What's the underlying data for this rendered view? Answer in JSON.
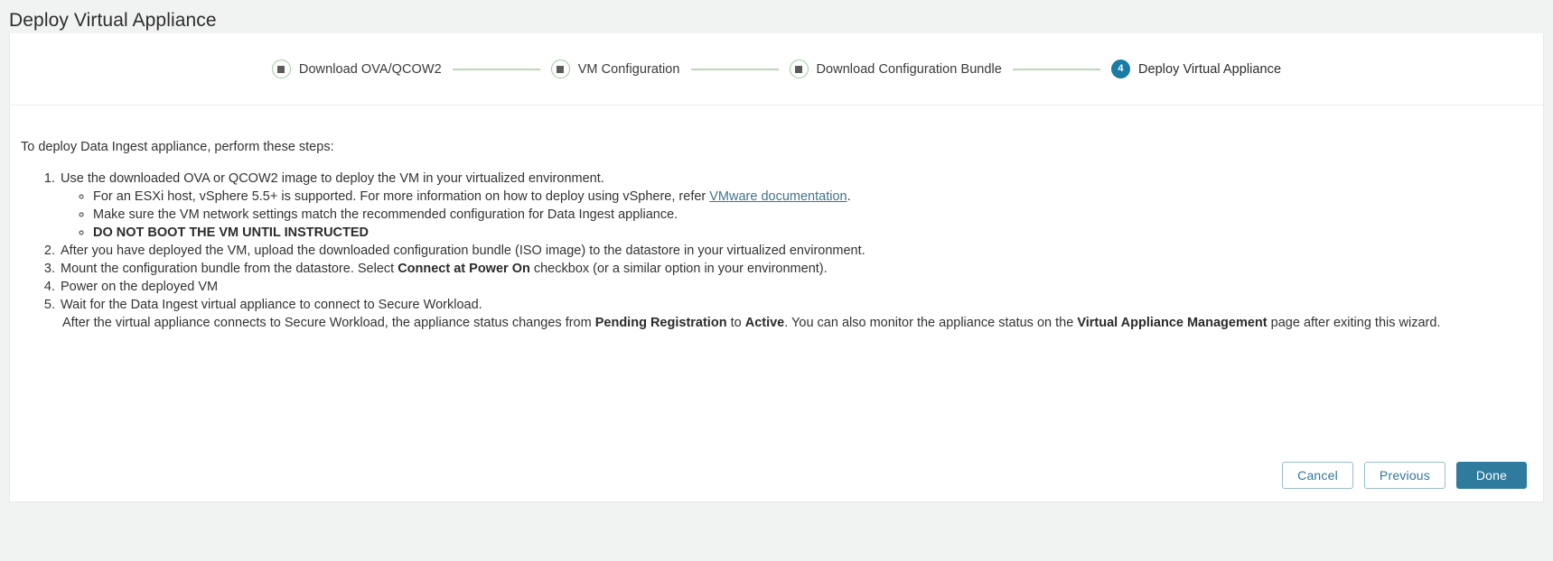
{
  "header": {
    "title": "Deploy Virtual Appliance"
  },
  "stepper": {
    "steps": [
      {
        "id": "download-ova",
        "label": "Download OVA/QCOW2",
        "state": "done",
        "number": "1",
        "icon": "square-marker-icon"
      },
      {
        "id": "vm-configuration",
        "label": "VM Configuration",
        "state": "done",
        "number": "2",
        "icon": "square-marker-icon"
      },
      {
        "id": "download-configuration-bundle",
        "label": "Download Configuration Bundle",
        "state": "done",
        "number": "3",
        "icon": "square-marker-icon"
      },
      {
        "id": "deploy-virtual-appliance",
        "label": "Deploy Virtual Appliance",
        "state": "current",
        "number": "4",
        "icon": "step-number-icon"
      }
    ]
  },
  "main": {
    "intro": "To deploy Data Ingest appliance, perform these steps:",
    "items": [
      {
        "text_before": "Use the downloaded OVA or QCOW2 image to deploy the VM in your virtualized environment.",
        "sub_items": [
          {
            "prefix": "For an ESXi host, vSphere 5.5+ is supported. For more information on how to deploy using vSphere, refer ",
            "link": "VMware documentation",
            "suffix": ".",
            "bold": false
          },
          {
            "prefix": "Make sure the VM network settings match the recommended configuration for Data Ingest appliance.",
            "link": "",
            "suffix": "",
            "bold": false
          },
          {
            "prefix": "DO NOT BOOT THE VM UNTIL INSTRUCTED",
            "link": "",
            "suffix": "",
            "bold": true
          }
        ]
      },
      {
        "text_before": "After you have deployed the VM, upload the downloaded configuration bundle (ISO image) to the datastore in your virtualized environment.",
        "sub_items": []
      },
      {
        "segments": [
          {
            "text": "Mount the configuration bundle from the datastore. Select ",
            "bold": false
          },
          {
            "text": "Connect at Power On",
            "bold": true
          },
          {
            "text": " checkbox (or a similar option in your environment).",
            "bold": false
          }
        ],
        "sub_items": []
      },
      {
        "text_before": "Power on the deployed VM",
        "sub_items": []
      },
      {
        "text_before": "Wait for the Data Ingest virtual appliance to connect to Secure Workload.",
        "followup_segments": [
          {
            "text": "After the virtual appliance connects to Secure Workload, the appliance status changes from ",
            "bold": false
          },
          {
            "text": "Pending Registration",
            "bold": true
          },
          {
            "text": " to ",
            "bold": false
          },
          {
            "text": "Active",
            "bold": true
          },
          {
            "text": ". You can also monitor the appliance status on the ",
            "bold": false
          },
          {
            "text": "Virtual Appliance Management",
            "bold": true
          },
          {
            "text": " page after exiting this wizard.",
            "bold": false
          }
        ],
        "sub_items": []
      }
    ]
  },
  "footer": {
    "cancel_label": "Cancel",
    "previous_label": "Previous",
    "done_label": "Done"
  },
  "colors": {
    "accent": "#2e7b9e",
    "step_done_ring": "#9ecb9e",
    "connector": "#b7d9b3",
    "link": "#41738c",
    "page_bg": "#f1f2f2"
  }
}
